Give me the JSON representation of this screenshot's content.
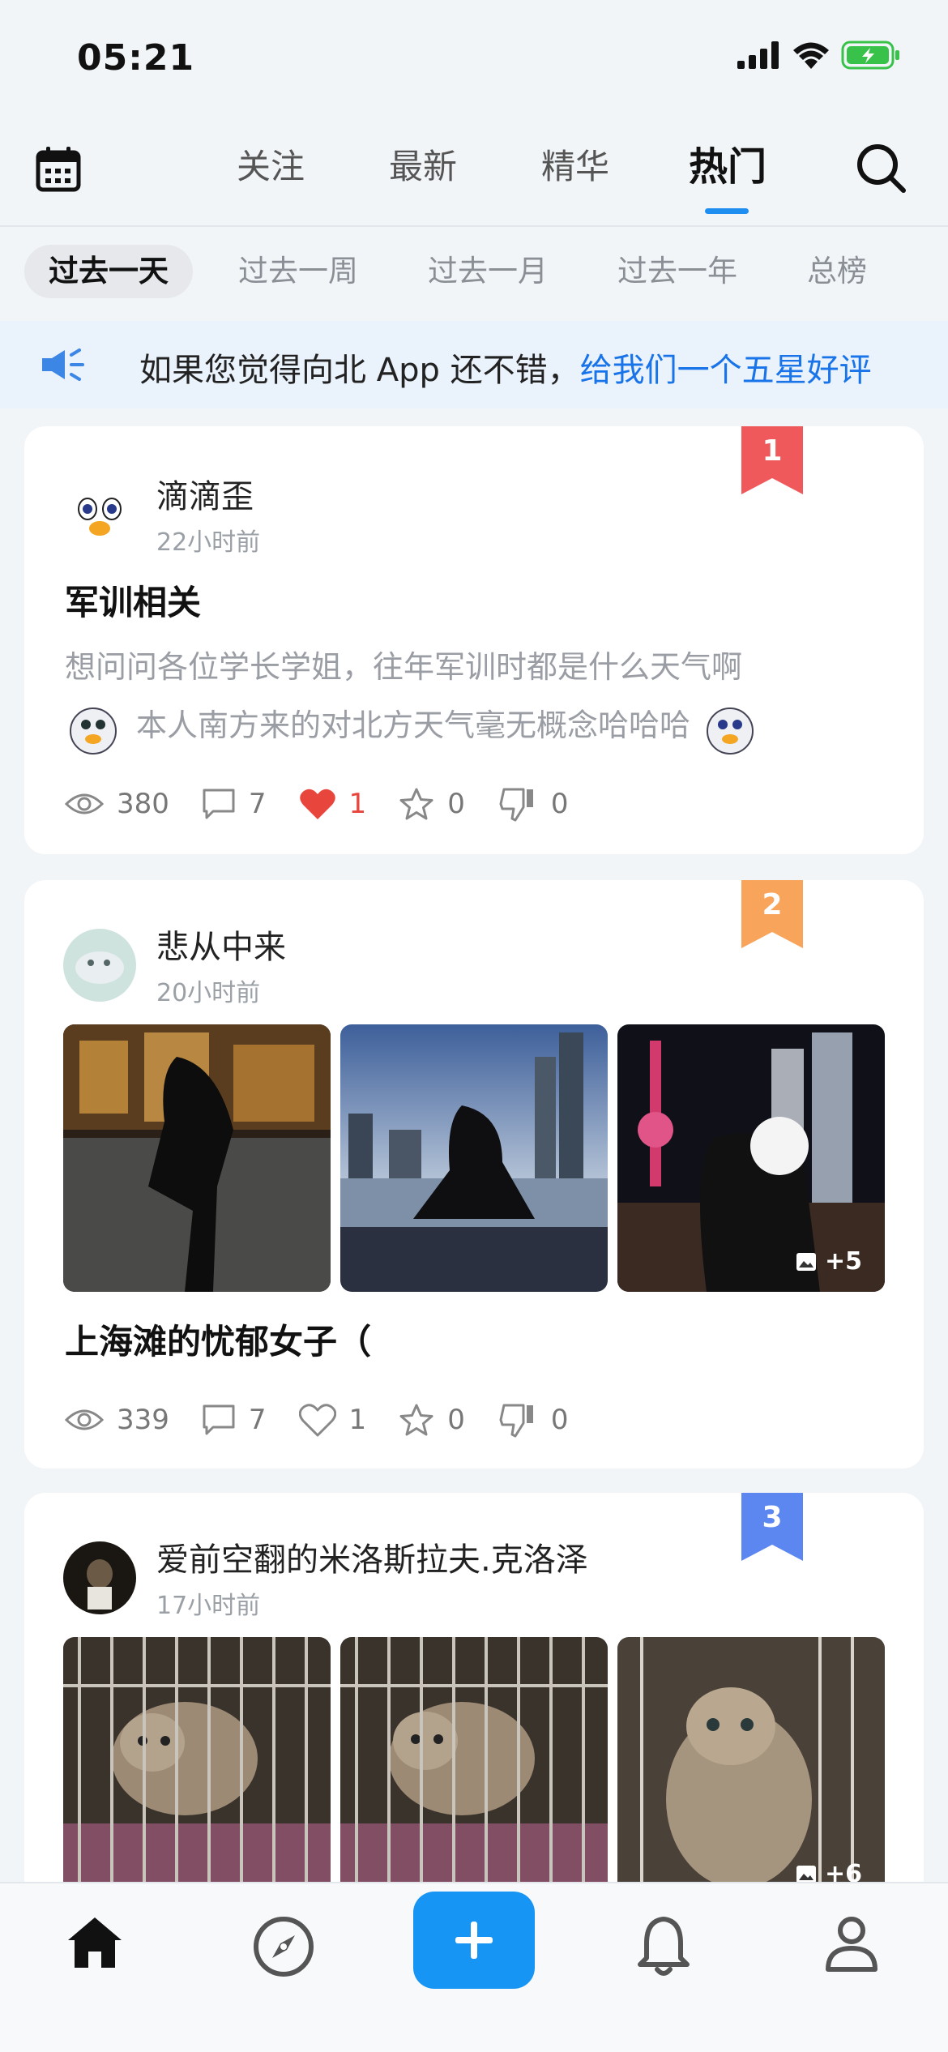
{
  "status_bar": {
    "time": "05:21"
  },
  "header": {
    "tabs": [
      {
        "label": "关注"
      },
      {
        "label": "最新"
      },
      {
        "label": "精华"
      },
      {
        "label": "热门"
      }
    ],
    "active_tab": "热门"
  },
  "filters": [
    {
      "label": "过去一天"
    },
    {
      "label": "过去一周"
    },
    {
      "label": "过去一月"
    },
    {
      "label": "过去一年"
    },
    {
      "label": "总榜"
    }
  ],
  "banner": {
    "text": "如果您觉得向北 App 还不错，",
    "link": "给我们一个五星好评"
  },
  "posts": [
    {
      "rank": "1",
      "rank_color": "#f0595c",
      "author": "滴滴歪",
      "time": "22小时前",
      "title": "军训相关",
      "body_line1": "想问问各位学长学姐，往年军训时都是什么天气啊",
      "body_line2": "本人南方来的对北方天气毫无概念哈哈哈",
      "views": "380",
      "comments": "7",
      "likes": "1",
      "liked": true,
      "stars": "0",
      "dislikes": "0"
    },
    {
      "rank": "2",
      "rank_color": "#f8a45a",
      "author": "悲从中来",
      "time": "20小时前",
      "title": "上海滩的忧郁女子（",
      "more_images": "+5",
      "views": "339",
      "comments": "7",
      "likes": "1",
      "liked": false,
      "stars": "0",
      "dislikes": "0"
    },
    {
      "rank": "3",
      "rank_color": "#5c87f0",
      "author": "爱前空翻的米洛斯拉夫.克洛泽",
      "time": "17小时前",
      "more_images": "+6"
    }
  ],
  "icons": {
    "calendar": "calendar-icon",
    "search": "search-icon",
    "speaker": "megaphone-icon",
    "nav": [
      "home-icon",
      "compass-icon",
      "plus-icon",
      "bell-icon",
      "person-icon"
    ]
  },
  "colors": {
    "accent": "#1795f5",
    "link": "#1874e8",
    "like": "#e8453c"
  }
}
